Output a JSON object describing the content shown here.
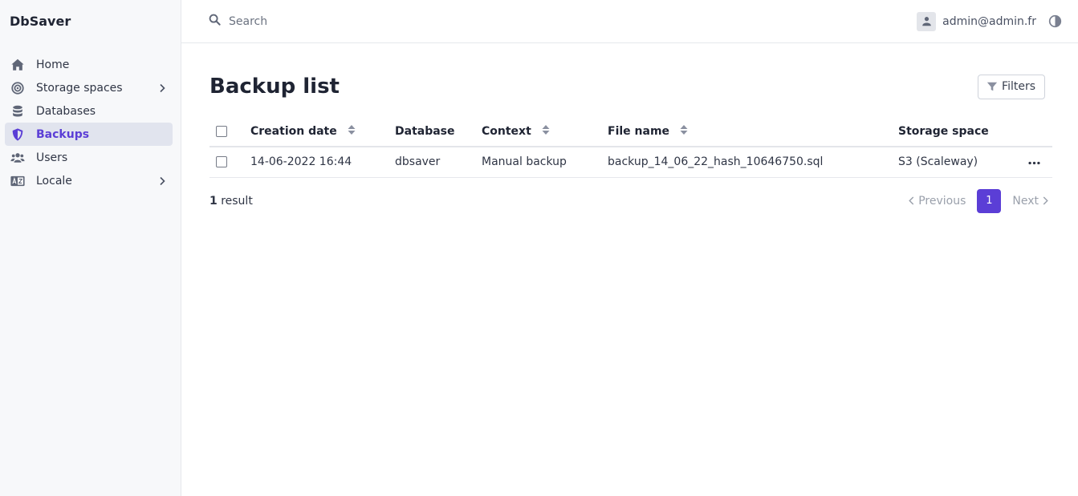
{
  "app": {
    "name": "DbSaver"
  },
  "sidebar": {
    "items": [
      {
        "label": "Home",
        "icon": "home-icon",
        "active": false,
        "chevron": false
      },
      {
        "label": "Storage spaces",
        "icon": "target-icon",
        "active": false,
        "chevron": true
      },
      {
        "label": "Databases",
        "icon": "database-icon",
        "active": false,
        "chevron": false
      },
      {
        "label": "Backups",
        "icon": "shield-icon",
        "active": true,
        "chevron": false
      },
      {
        "label": "Users",
        "icon": "users-icon",
        "active": false,
        "chevron": false
      },
      {
        "label": "Locale",
        "icon": "language-icon",
        "active": false,
        "chevron": true
      }
    ]
  },
  "topbar": {
    "search_placeholder": "Search",
    "user_email": "admin@admin.fr"
  },
  "page": {
    "title": "Backup list",
    "filters_label": "Filters"
  },
  "table": {
    "headers": {
      "creation_date": "Creation date",
      "database": "Database",
      "context": "Context",
      "file_name": "File name",
      "storage_space": "Storage space"
    },
    "rows": [
      {
        "creation_date": "14-06-2022 16:44",
        "database": "dbsaver",
        "context": "Manual backup",
        "file_name": "backup_14_06_22_hash_10646750.sql",
        "storage_space": "S3 (Scaleway)"
      }
    ]
  },
  "footer": {
    "result_count": "1",
    "result_label": " result",
    "previous": "Previous",
    "current_page": "1",
    "next": "Next"
  },
  "colors": {
    "accent": "#5b3ed6",
    "active_bg": "#e1e4ee",
    "sidebar_bg": "#f7f8fa"
  }
}
